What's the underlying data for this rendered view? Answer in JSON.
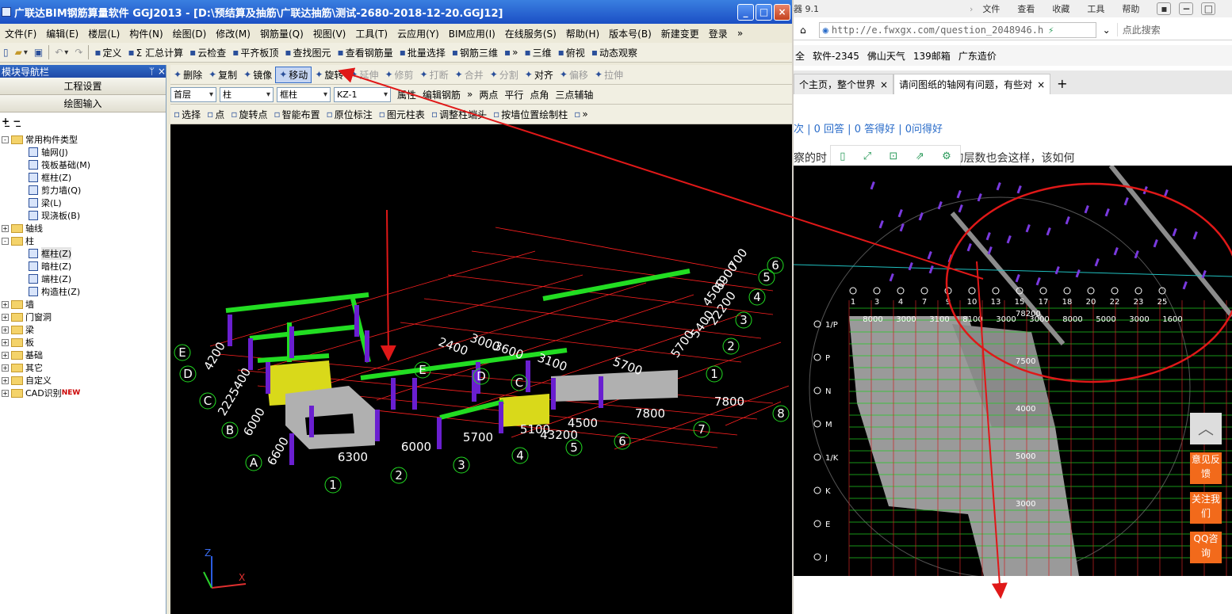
{
  "app": {
    "title": "广联达BIM钢筋算量软件 GGJ2013 - [D:\\预结算及抽筋\\广联达抽筋\\测试-2680-2018-12-20.GGJ12]",
    "window_buttons": [
      "_",
      "□",
      "×"
    ]
  },
  "menu": [
    "文件(F)",
    "编辑(E)",
    "楼层(L)",
    "构件(N)",
    "绘图(D)",
    "修改(M)",
    "钢筋量(Q)",
    "视图(V)",
    "工具(T)",
    "云应用(Y)",
    "BIM应用(I)",
    "在线服务(S)",
    "帮助(H)",
    "版本号(B)",
    "新建变更",
    "登录",
    "»"
  ],
  "toolbar1": [
    "定义",
    "Σ 汇总计算",
    "云检查",
    "平齐板顶",
    "查找图元",
    "查看钢筋量",
    "批量选择",
    "钢筋三维",
    "»",
    "三维",
    "俯视",
    "动态观察"
  ],
  "toolbar2": {
    "items": [
      "删除",
      "复制",
      "镜像",
      "移动",
      "旋转",
      "延伸",
      "修剪",
      "打断",
      "合并",
      "分割",
      "对齐",
      "偏移",
      "拉伸"
    ],
    "disabled": [
      "延伸",
      "修剪",
      "打断",
      "合并",
      "分割",
      "偏移",
      "拉伸"
    ],
    "active": "移动"
  },
  "toolbar3": {
    "floor": "首层",
    "category": "柱",
    "type": "框柱",
    "name": "KZ-1",
    "items": [
      "属性",
      "编辑钢筋",
      "»",
      "两点",
      "平行",
      "点角",
      "三点辅轴"
    ]
  },
  "toolbar4": [
    "选择",
    "点",
    "旋转点",
    "智能布置",
    "原位标注",
    "图元柱表",
    "调整柱端头",
    "按墙位置绘制柱",
    "»"
  ],
  "nav": {
    "header": "模块导航栏",
    "pin": "ᛘ ×",
    "buttons": [
      "工程设置",
      "绘图输入"
    ],
    "tree": [
      {
        "level": 0,
        "expand": "-",
        "label": "常用构件类型",
        "folder": true
      },
      {
        "level": 1,
        "label": "轴网(J)"
      },
      {
        "level": 1,
        "label": "筏板基础(M)"
      },
      {
        "level": 1,
        "label": "框柱(Z)"
      },
      {
        "level": 1,
        "label": "剪力墙(Q)"
      },
      {
        "level": 1,
        "label": "梁(L)"
      },
      {
        "level": 1,
        "label": "现浇板(B)"
      },
      {
        "level": 0,
        "expand": "+",
        "label": "轴线",
        "folder": true
      },
      {
        "level": 0,
        "expand": "-",
        "label": "柱",
        "folder": true
      },
      {
        "level": 1,
        "label": "框柱(Z)",
        "selected": true
      },
      {
        "level": 1,
        "label": "暗柱(Z)"
      },
      {
        "level": 1,
        "label": "端柱(Z)"
      },
      {
        "level": 1,
        "label": "构造柱(Z)"
      },
      {
        "level": 0,
        "expand": "+",
        "label": "墙",
        "folder": true
      },
      {
        "level": 0,
        "expand": "+",
        "label": "门窗洞",
        "folder": true
      },
      {
        "level": 0,
        "expand": "+",
        "label": "梁",
        "folder": true
      },
      {
        "level": 0,
        "expand": "+",
        "label": "板",
        "folder": true
      },
      {
        "level": 0,
        "expand": "+",
        "label": "基础",
        "folder": true
      },
      {
        "level": 0,
        "expand": "+",
        "label": "其它",
        "folder": true
      },
      {
        "level": 0,
        "expand": "+",
        "label": "自定义",
        "folder": true
      },
      {
        "level": 0,
        "expand": "+",
        "label": "CAD识别",
        "folder": true,
        "badge": "NEW"
      }
    ]
  },
  "viewport": {
    "axis_letters": [
      "E",
      "D",
      "C",
      "B",
      "A"
    ],
    "axis_numbers_front": [
      "1",
      "2",
      "3",
      "4",
      "5",
      "6",
      "7",
      "8"
    ],
    "axis_numbers_right": [
      "1",
      "2",
      "3",
      "4",
      "5",
      "6"
    ],
    "dims_front": [
      "6300",
      "6000",
      "5700",
      "43200",
      "5100",
      "4500",
      "7800",
      "7800"
    ],
    "dims_left": [
      "6600",
      "6000",
      "2225400",
      "4200"
    ],
    "dims_right": [
      "5700",
      "5400",
      "22200",
      "4500",
      "6900",
      "700"
    ],
    "dims_inner": [
      "2400",
      "3000",
      "3600",
      "3100",
      "5700"
    ],
    "inner_letters": [
      "E",
      "D",
      "C"
    ],
    "coord_labels": [
      "Z",
      "X"
    ]
  },
  "browser": {
    "top_text": "器 9.1",
    "top_menu": [
      "文件",
      "查看",
      "收藏",
      "工具",
      "帮助"
    ],
    "url": "http://e.fwxgx.com/question_2048946.h",
    "search_placeholder": "点此搜索",
    "favorites": [
      "全",
      "软件-2345",
      "佛山天气",
      "139邮箱",
      "广东造价"
    ],
    "tabs": [
      {
        "label": "个主页，整个世界",
        "active": false
      },
      {
        "label": "请问图纸的轴网有问题，有些对",
        "active": true
      }
    ],
    "stats": "次 | 0 回答 | 0 答得好 | 0问得好",
    "question_text": "察的时                        是一样的情况，估计后面的层数也会这样，该如何",
    "image_tools": [
      "▯",
      "⤢",
      "⊡",
      "⇗",
      "⚙"
    ],
    "side_buttons": [
      "︿",
      "意见反馈",
      "关注我们",
      "QQ咨询"
    ],
    "embed_dims": [
      "8000",
      "3000",
      "3100",
      "8100",
      "3000",
      "3000",
      "8000",
      "5000",
      "3000",
      "1600"
    ],
    "embed_axis": [
      "1",
      "3",
      "4",
      "7",
      "9",
      "10",
      "13",
      "15",
      "17",
      "18",
      "20",
      "22",
      "23",
      "25"
    ],
    "embed_left": [
      "1/P",
      "P",
      "N",
      "M",
      "1/K",
      "K",
      "E",
      "J"
    ],
    "embed_right_dims": [
      "78200",
      "7500",
      "4000",
      "5000",
      "3000"
    ]
  },
  "colors": {
    "titlebar": "#1b4fc4",
    "grid": "#ff2020",
    "beam": "#22dd22",
    "column": "#6a1fd0",
    "wall": "#b0b0b0",
    "slab": "#d9d91a",
    "arrow": "#e01818"
  }
}
